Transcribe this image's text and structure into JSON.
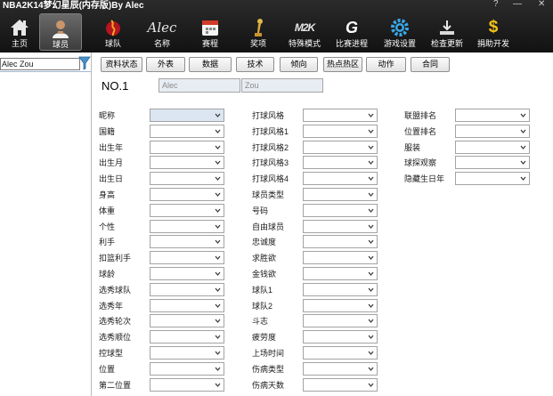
{
  "window": {
    "title": "NBA2K14梦幻星辰(内存版)By Alec",
    "controls": [
      "?",
      "—",
      "✕"
    ]
  },
  "toolbar": [
    {
      "label": "主页",
      "icon": "home-icon"
    },
    {
      "label": "球员",
      "icon": "player-icon",
      "active": true
    },
    {
      "label": "球队",
      "icon": "team-logo-icon"
    },
    {
      "label": "名称",
      "icon": "alec-signature-icon",
      "icon_text": "Alec"
    },
    {
      "label": "赛程",
      "icon": "calendar-icon"
    },
    {
      "label": "奖项",
      "icon": "trophy-icon"
    },
    {
      "label": "特殊模式",
      "icon": "m2k-logo-icon",
      "icon_text": "M2K"
    },
    {
      "label": "比赛进程",
      "icon": "gatorade-g-icon",
      "icon_text": "G"
    },
    {
      "label": "游戏设置",
      "icon": "gear-icon"
    },
    {
      "label": "检查更新",
      "icon": "download-icon"
    },
    {
      "label": "捐助开发",
      "icon": "dollar-icon",
      "icon_text": "$"
    }
  ],
  "left_panel": {
    "search_value": "Alec Zou",
    "filter_icon": "funnel-icon"
  },
  "tabs": [
    "资料状态",
    "外表",
    "数据",
    "技术",
    "倾向",
    "热点热区",
    "动作",
    "合同"
  ],
  "player": {
    "number_label": "NO.1",
    "first_name": "Alec",
    "last_name": "Zou"
  },
  "fields": {
    "col1": [
      "昵称",
      "国籍",
      "出生年",
      "出生月",
      "出生日",
      "身高",
      "体重",
      "个性",
      "利手",
      "扣篮利手",
      "球龄",
      "选秀球队",
      "选秀年",
      "选秀轮次",
      "选秀顺位",
      "控球型",
      "位置",
      "第二位置"
    ],
    "col2": [
      "打球风格",
      "打球风格1",
      "打球风格2",
      "打球风格3",
      "打球风格4",
      "球员类型",
      "号码",
      "自由球员",
      "忠诚度",
      "求胜欲",
      "金钱欲",
      "球队1",
      "球队2",
      "斗志",
      "疲劳度",
      "上场时间",
      "伤病类型",
      "伤病天数"
    ],
    "col3": [
      "联盟排名",
      "位置排名",
      "服装",
      "球探观察",
      "隐藏生日年"
    ]
  },
  "colors": {
    "toolbar_bg": "#1c1c1c",
    "combo_border": "#a3a3a3",
    "combo_arrow": "#333333",
    "first_combo_bg": "#dce6f2",
    "name_box_bg": "#e8edf3"
  }
}
